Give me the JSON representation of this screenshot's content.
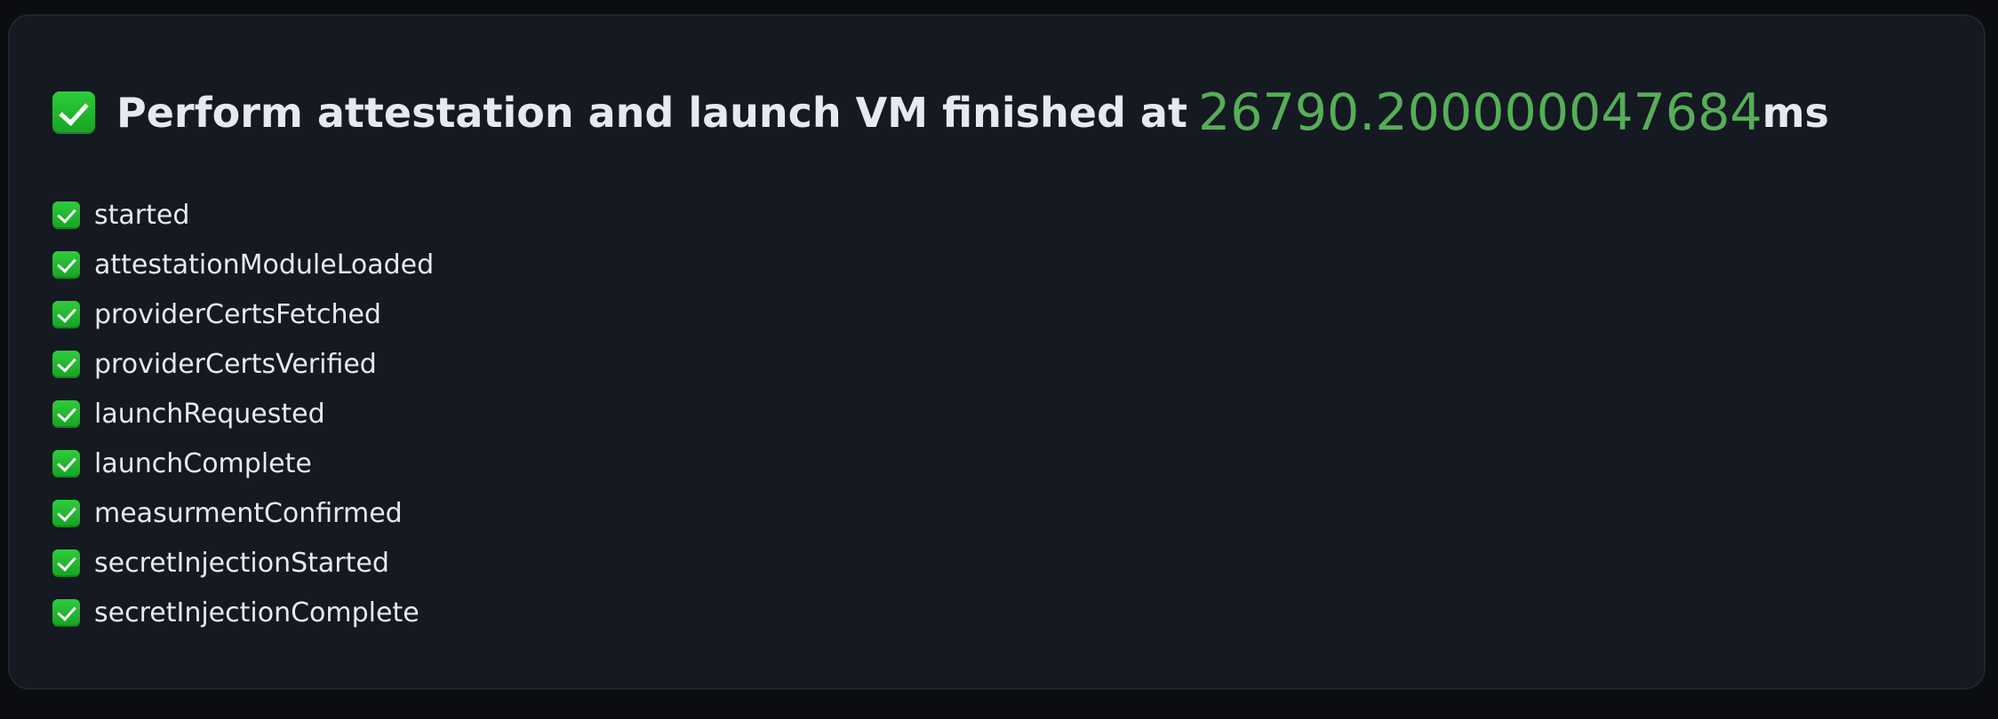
{
  "header": {
    "title_text": "Perform attestation and launch VM finished at",
    "elapsed_value": "26790.200000047684",
    "elapsed_unit": "ms"
  },
  "steps": [
    {
      "label": "started",
      "status": "check-icon"
    },
    {
      "label": "attestationModuleLoaded",
      "status": "check-icon"
    },
    {
      "label": "providerCertsFetched",
      "status": "check-icon"
    },
    {
      "label": "providerCertsVerified",
      "status": "check-icon"
    },
    {
      "label": "launchRequested",
      "status": "check-icon"
    },
    {
      "label": "launchComplete",
      "status": "check-icon"
    },
    {
      "label": "measurmentConfirmed",
      "status": "check-icon"
    },
    {
      "label": "secretInjectionStarted",
      "status": "check-icon"
    },
    {
      "label": "secretInjectionComplete",
      "status": "check-icon"
    }
  ],
  "colors": {
    "background": "#0b0d10",
    "card": "#141922",
    "text": "#e6e9ef",
    "accent_green": "#56ae57",
    "check_green": "#1fb42d"
  }
}
